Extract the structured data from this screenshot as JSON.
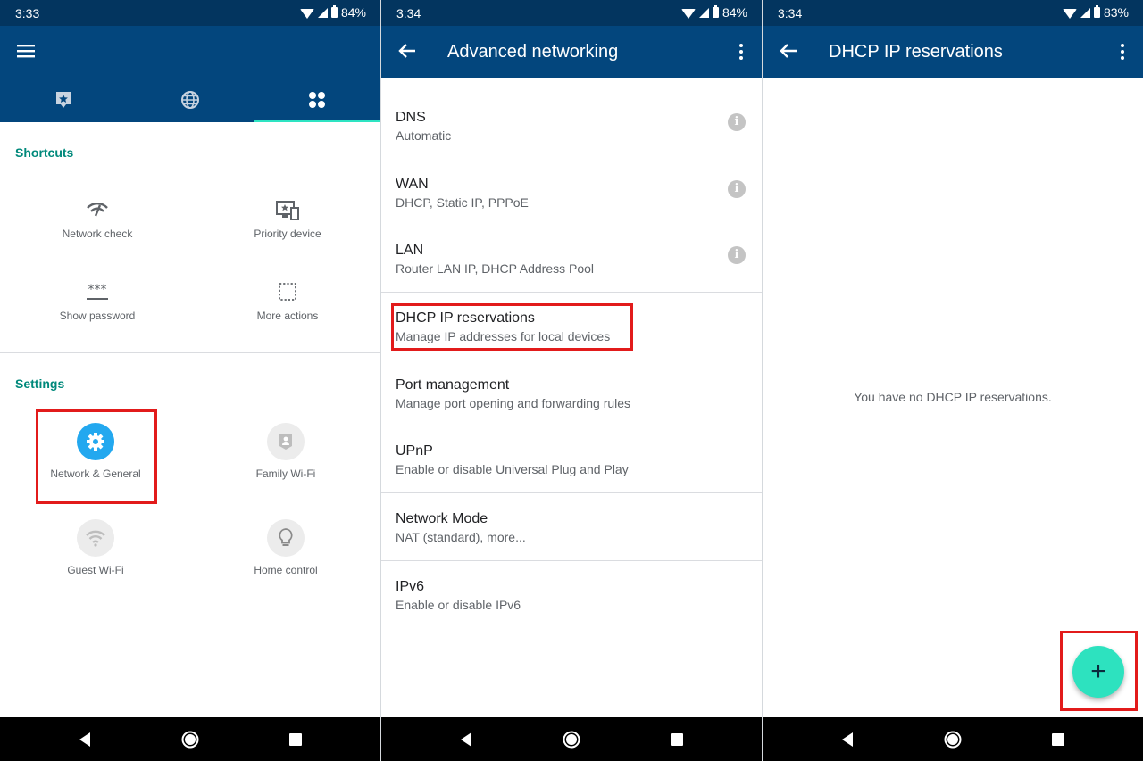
{
  "panel1": {
    "status": {
      "time": "3:33",
      "battery": "84%"
    },
    "tabs": [
      {
        "icon": "star-card-icon",
        "active": false
      },
      {
        "icon": "globe-icon",
        "active": false
      },
      {
        "icon": "grid-icon",
        "active": true
      }
    ],
    "shortcuts_title": "Shortcuts",
    "shortcuts": [
      {
        "label": "Network check",
        "icon": "network-check-icon"
      },
      {
        "label": "Priority device",
        "icon": "priority-device-icon"
      },
      {
        "label": "Show password",
        "icon": "password-icon"
      },
      {
        "label": "More actions",
        "icon": "more-actions-icon"
      }
    ],
    "settings_title": "Settings",
    "settings": [
      {
        "label": "Network & General",
        "icon": "gear-icon",
        "color": "#23a8ef"
      },
      {
        "label": "Family Wi-Fi",
        "icon": "family-icon"
      },
      {
        "label": "Guest Wi-Fi",
        "icon": "wifi-icon"
      },
      {
        "label": "Home control",
        "icon": "lightbulb-icon"
      }
    ]
  },
  "panel2": {
    "status": {
      "time": "3:34",
      "battery": "84%"
    },
    "title": "Advanced networking",
    "items": [
      {
        "primary": "DNS",
        "secondary": "Automatic",
        "info": true
      },
      {
        "primary": "WAN",
        "secondary": "DHCP, Static IP, PPPoE",
        "info": true
      },
      {
        "primary": "LAN",
        "secondary": "Router LAN IP, DHCP Address Pool",
        "info": true
      },
      {
        "primary": "DHCP IP reservations",
        "secondary": "Manage IP addresses for local devices"
      },
      {
        "primary": "Port management",
        "secondary": "Manage port opening and forwarding rules"
      },
      {
        "primary": "UPnP",
        "secondary": "Enable or disable Universal Plug and Play"
      },
      {
        "primary": "Network Mode",
        "secondary": "NAT (standard), more..."
      },
      {
        "primary": "IPv6",
        "secondary": "Enable or disable IPv6"
      }
    ]
  },
  "panel3": {
    "status": {
      "time": "3:34",
      "battery": "83%"
    },
    "title": "DHCP IP reservations",
    "empty_message": "You have no DHCP IP reservations.",
    "fab_label": "+"
  },
  "colors": {
    "statusbar": "#03355f",
    "appbar": "#03467d",
    "accent_teal": "#2ee4c2",
    "section_title": "#00897b",
    "highlight_red": "#e21b1b"
  }
}
